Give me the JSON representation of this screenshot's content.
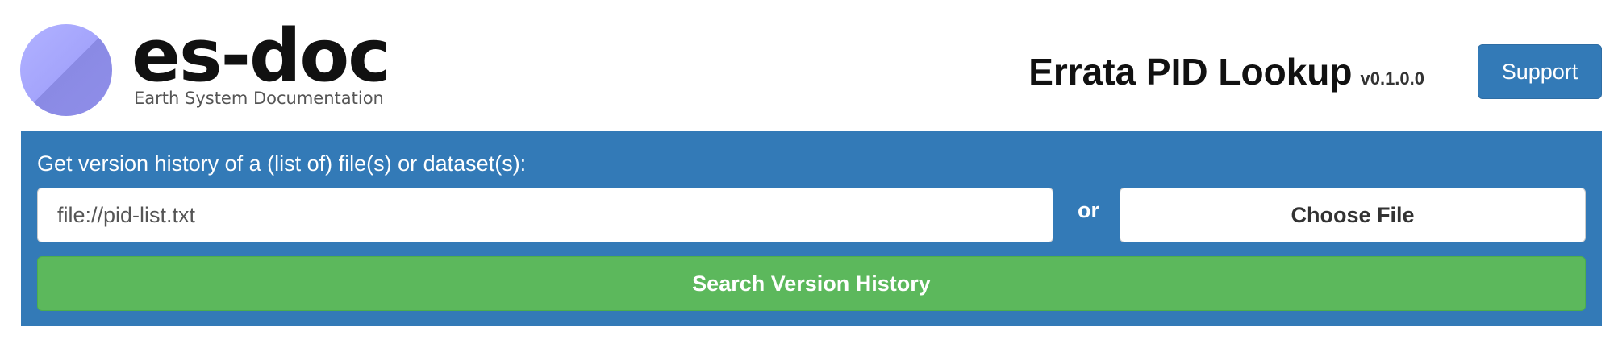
{
  "header": {
    "logo_text": "es-doc",
    "logo_subtitle": "Earth System Documentation",
    "app_title": "Errata PID Lookup",
    "app_version": "v0.1.0.0",
    "support_label": "Support"
  },
  "search_panel": {
    "label": "Get version history of a (list of) file(s) or dataset(s):",
    "input_value": "file://pid-list.txt",
    "or_label": "or",
    "choose_file_label": "Choose File",
    "search_button_label": "Search Version History"
  },
  "colors": {
    "primary": "#337ab7",
    "success": "#5cb85c",
    "logo_circle": "#a4a4fc"
  }
}
